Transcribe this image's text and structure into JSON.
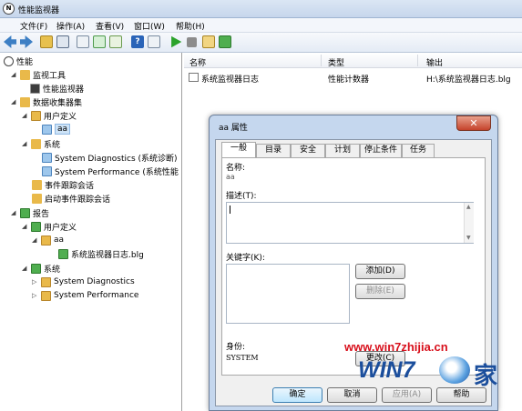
{
  "window": {
    "title": "性能监视器",
    "app_icon": "perfmon-icon"
  },
  "menu": [
    "文件(F)",
    "操作(A)",
    "查看(V)",
    "窗口(W)",
    "帮助(H)"
  ],
  "toolbar": {
    "buttons": [
      "back-icon",
      "forward-icon",
      "up-icon",
      "show-tree-icon",
      "properties-icon",
      "refresh-icon",
      "export-icon",
      "help-icon",
      "view-icon",
      "start-icon",
      "stop-icon",
      "new-icon",
      "download-icon"
    ]
  },
  "tree": {
    "root": "性能",
    "monitor_tools": "监视工具",
    "perf_monitor": "性能监视器",
    "collector_sets": "数据收集器集",
    "user_defined": "用户定义",
    "aa": "aa",
    "system": "系统",
    "sys_diag": "System Diagnostics (系统诊断)",
    "sys_perf": "System Performance (系统性能",
    "event_trace": "事件跟踪会话",
    "startup_trace": "启动事件跟踪会话",
    "reports": "报告",
    "r_user_defined": "用户定义",
    "r_aa": "aa",
    "r_log": "系统监视器日志.blg",
    "r_system": "系统",
    "r_sys_diag": "System Diagnostics",
    "r_sys_perf": "System Performance"
  },
  "list": {
    "columns": [
      "名称",
      "类型",
      "输出"
    ],
    "rows": [
      {
        "name": "系统监视器日志",
        "type": "性能计数器",
        "output": "H:\\系统监视器日志.blg"
      }
    ]
  },
  "dialog": {
    "title": "aa 属性",
    "close": "✕",
    "tabs": [
      "一般",
      "目录",
      "安全",
      "计划",
      "停止条件",
      "任务"
    ],
    "name_label": "名称:",
    "name_value": "aa",
    "desc_label": "描述(T):",
    "desc_value": "",
    "keywords_label": "关键字(K):",
    "add_button": "添加(D)",
    "delete_button": "删除(E)",
    "identity_label": "身份:",
    "identity_value": "SYSTEM",
    "change_button": "更改(C)",
    "ok": "确定",
    "cancel": "取消",
    "apply": "应用(A)",
    "help": "帮助"
  },
  "watermark": {
    "url": "www.win7zhijia.cn",
    "logo": "WIN7",
    "suffix": "家"
  }
}
